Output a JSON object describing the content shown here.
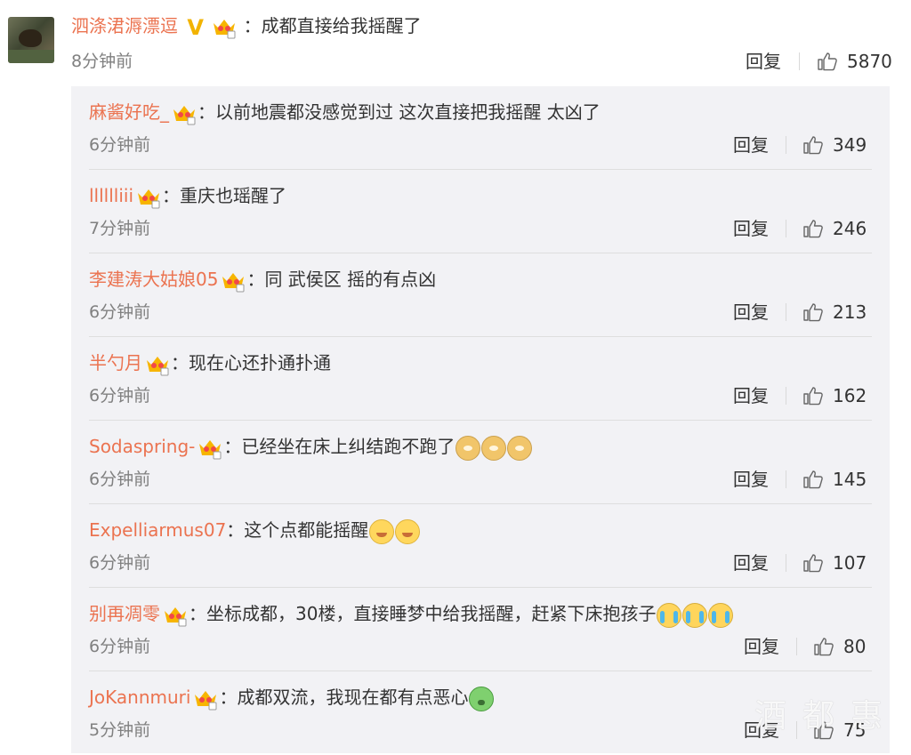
{
  "main_comment": {
    "user": "泗涤涒溽漂逗",
    "verified_mark": "V",
    "text": "：成都直接给我摇醒了",
    "time": "8分钟前",
    "reply_label": "回复",
    "likes": "5870"
  },
  "replies": [
    {
      "user": "麻酱好吃_",
      "has_badge": true,
      "text": "：以前地震都没感觉到过 这次直接把我摇醒 太凶了",
      "emojis": [],
      "time": "6分钟前",
      "reply_label": "回复",
      "likes": "349"
    },
    {
      "user": "lllllliii",
      "has_badge": true,
      "text": "：重庆也瑶醒了",
      "emojis": [],
      "time": "7分钟前",
      "reply_label": "回复",
      "likes": "246"
    },
    {
      "user": "李建涛大姑娘05",
      "has_badge": true,
      "text": "：同 武侯区 摇的有点凶",
      "emojis": [],
      "time": "6分钟前",
      "reply_label": "回复",
      "likes": "213"
    },
    {
      "user": "半勺月",
      "has_badge": true,
      "text": "：现在心还扑通扑通",
      "emojis": [],
      "time": "6分钟前",
      "reply_label": "回复",
      "likes": "162"
    },
    {
      "user": "Sodaspring-",
      "has_badge": true,
      "text": "：已经坐在床上纠结跑不跑了",
      "emojis": [
        "doge-icon",
        "doge-icon",
        "doge-icon"
      ],
      "time": "6分钟前",
      "reply_label": "回复",
      "likes": "145"
    },
    {
      "user": "Expelliarmus07",
      "has_badge": false,
      "text": "：这个点都能摇醒",
      "emojis": [
        "grin-icon",
        "grin-icon"
      ],
      "time": "6分钟前",
      "reply_label": "回复",
      "likes": "107"
    },
    {
      "user": "别再凋零",
      "has_badge": true,
      "text": "：坐标成都，30楼，直接睡梦中给我摇醒，赶紧下床抱孩子",
      "emojis": [
        "cry-icon",
        "cry-icon",
        "cry-icon"
      ],
      "time": "6分钟前",
      "reply_label": "回复",
      "likes": "80"
    },
    {
      "user": "JoKannmuri",
      "has_badge": true,
      "text": "：成都双流，我现在都有点恶心",
      "emojis": [
        "sick-icon"
      ],
      "time": "5分钟前",
      "reply_label": "回复",
      "likes": "75"
    }
  ],
  "watermark": "酒都惠",
  "colors": {
    "username": "#eb7350",
    "verified": "#f2b300",
    "reply_bg": "#f2f2f5"
  }
}
